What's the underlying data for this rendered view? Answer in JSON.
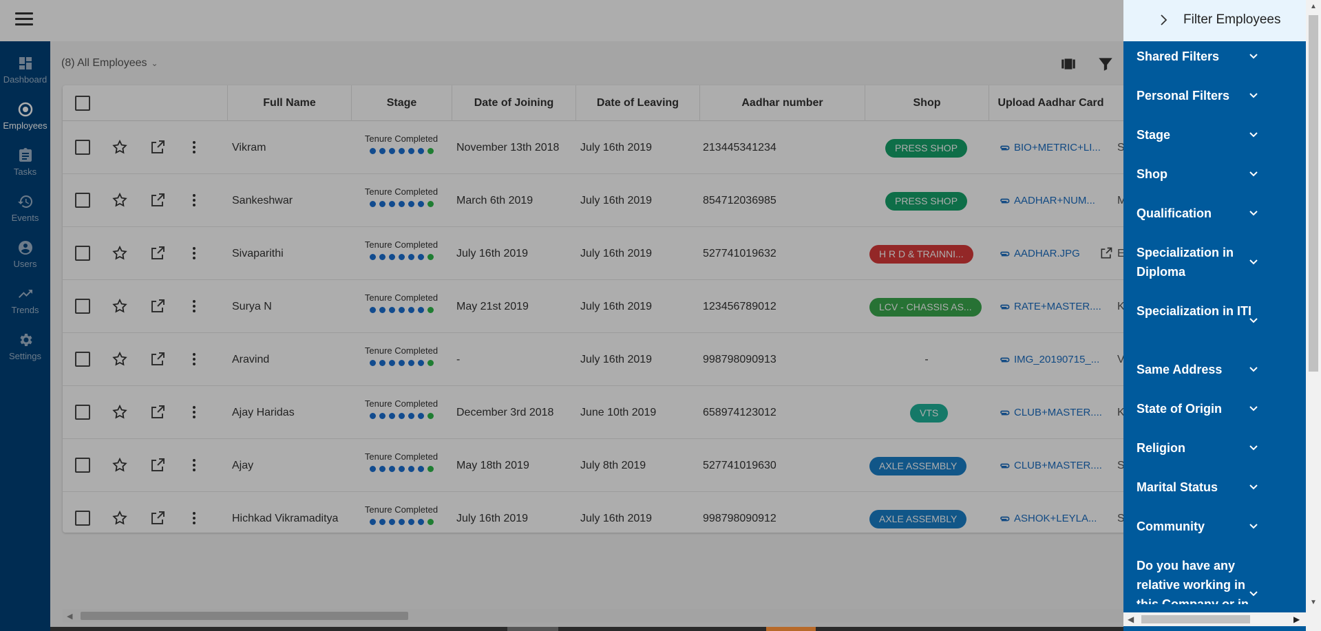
{
  "sidebar": {
    "items": [
      {
        "label": "Dashboard",
        "icon": "dashboard-icon"
      },
      {
        "label": "Employees",
        "icon": "employees-icon"
      },
      {
        "label": "Tasks",
        "icon": "clipboard-icon"
      },
      {
        "label": "Events",
        "icon": "history-icon"
      },
      {
        "label": "Users",
        "icon": "user-icon"
      },
      {
        "label": "Trends",
        "icon": "trend-icon"
      },
      {
        "label": "Settings",
        "icon": "gear-icon"
      }
    ]
  },
  "header": {
    "view_title": "(8) All Employees"
  },
  "table": {
    "columns": [
      "Full Name",
      "Stage",
      "Date of Joining",
      "Date of Leaving",
      "Aadhar number",
      "Shop",
      "Upload Aadhar Card"
    ],
    "rows": [
      {
        "name": "Vikram",
        "stage": "Tenure Completed",
        "joining": "November 13th 2018",
        "leaving": "July 16th 2019",
        "aadhar": "213445341234",
        "shop": "PRESS SHOP",
        "file": "BIO+METRIC+LI...",
        "next": "Si"
      },
      {
        "name": "Sankeshwar",
        "stage": "Tenure Completed",
        "joining": "March 6th 2019",
        "leaving": "July 16th 2019",
        "aadhar": "854712036985",
        "shop": "PRESS SHOP",
        "file": "AADHAR+NUM...",
        "next": "M"
      },
      {
        "name": "Sivaparithi",
        "stage": "Tenure Completed",
        "joining": "July 16th 2019",
        "leaving": "July 16th 2019",
        "aadhar": "527741019632",
        "shop": "H R D & TRAINNI...",
        "file": "AADHAR.JPG",
        "next": "E"
      },
      {
        "name": "Surya N",
        "stage": "Tenure Completed",
        "joining": "May 21st 2019",
        "leaving": "July 16th 2019",
        "aadhar": "123456789012",
        "shop": "LCV - CHASSIS AS...",
        "file": "RATE+MASTER....",
        "next": "K"
      },
      {
        "name": "Aravind",
        "stage": "Tenure Completed",
        "joining": "-",
        "leaving": "July 16th 2019",
        "aadhar": "998798090913",
        "shop": "-",
        "file": "IMG_20190715_...",
        "next": "V"
      },
      {
        "name": "Ajay Haridas",
        "stage": "Tenure Completed",
        "joining": "December 3rd 2018",
        "leaving": "June 10th 2019",
        "aadhar": "658974123012",
        "shop": "VTS",
        "file": "CLUB+MASTER....",
        "next": "K"
      },
      {
        "name": "Ajay",
        "stage": "Tenure Completed",
        "joining": "May 18th 2019",
        "leaving": "July 8th 2019",
        "aadhar": "527741019630",
        "shop": "AXLE ASSEMBLY",
        "file": "CLUB+MASTER....",
        "next": "Si"
      },
      {
        "name": "Hichkad Vikramaditya",
        "stage": "Tenure Completed",
        "joining": "July 16th 2019",
        "leaving": "July 16th 2019",
        "aadhar": "998798090912",
        "shop": "AXLE ASSEMBLY",
        "file": "ASHOK+LEYLA...",
        "next": "Si"
      }
    ],
    "shop_colors": {
      "PRESS SHOP": "#16a36a",
      "H R D & TRAINNI...": "#d93a3a",
      "LCV - CHASSIS AS...": "#3aa84d",
      "VTS": "#1fb39a",
      "AXLE ASSEMBLY": "#1a7fc9"
    }
  },
  "drawer": {
    "title": "Filter Employees",
    "filters": [
      "Shared Filters",
      "Personal Filters",
      "Stage",
      "Shop",
      "Qualification",
      "Specialization in Diploma",
      "Specialization in ITI",
      "Same Address",
      "State of Origin",
      "Religion",
      "Marital Status",
      "Community",
      "Do you have any relative working in this Company or in"
    ]
  },
  "colors": {
    "sidebar": "#00427a",
    "drawer": "#005a9c",
    "drawer_header": "#e8f4fd",
    "link": "#1b6dc1",
    "stage_dot": "#1a6fd1",
    "stage_dot_last": "#2eb84a"
  }
}
